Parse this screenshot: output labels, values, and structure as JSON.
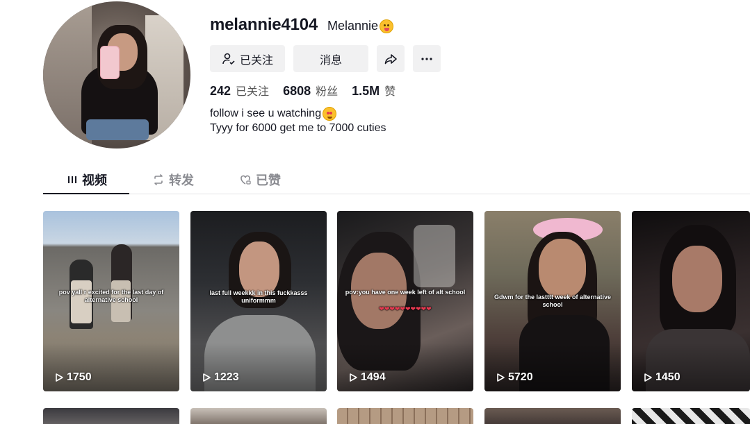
{
  "profile": {
    "username": "melannie4104",
    "nickname": "Melannie",
    "bio_line1": "follow i see u watching",
    "bio_line2": "Tyyy for 6000 get me to 7000 cuties"
  },
  "actions": {
    "follow_label": "已关注",
    "message_label": "消息",
    "share_icon": "share-icon",
    "more_icon": "more-icon"
  },
  "stats": {
    "following_count": "242",
    "following_label": "已关注",
    "followers_count": "6808",
    "followers_label": "粉丝",
    "likes_count": "1.5M",
    "likes_label": "赞"
  },
  "tabs": [
    {
      "label": "视频",
      "icon": "grid-icon",
      "active": true
    },
    {
      "label": "转发",
      "icon": "repost-icon",
      "active": false
    },
    {
      "label": "已赞",
      "icon": "heart-icon",
      "active": false
    }
  ],
  "videos": [
    {
      "caption": "pov yall r excited for the last day of alternative school",
      "views": "1750"
    },
    {
      "caption": "last full weekkk in this fuckkasss uniformmm",
      "views": "1223"
    },
    {
      "caption": "pov:you have one week left of alt school",
      "views": "1494"
    },
    {
      "caption": "Gdwm for the lastttt week of alternative school",
      "views": "5720"
    },
    {
      "caption": "",
      "views": "1450"
    }
  ]
}
